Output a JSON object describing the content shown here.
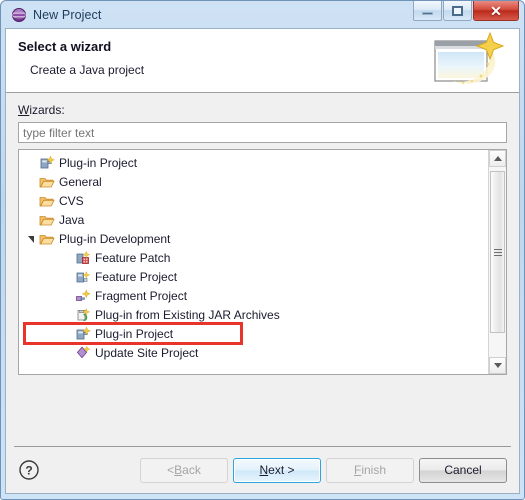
{
  "window": {
    "title": "New Project",
    "icon": "eclipse-sphere-icon",
    "controls": {
      "minimize": "Minimize",
      "maximize": "Maximize",
      "close": "Close",
      "close_glyph": "✕"
    }
  },
  "banner": {
    "title": "Select a wizard",
    "subtitle": "Create a Java project",
    "icon": "wizard-sparkle-icon"
  },
  "form": {
    "wizards_label_mnemonic": "W",
    "wizards_label_rest": "izards:",
    "filter_placeholder": "type filter text",
    "filter_value": ""
  },
  "tree": {
    "items": [
      {
        "label": "Plug-in Project",
        "level": 0,
        "twisty": "none",
        "icon": "plugin-project-icon",
        "highlighted": false
      },
      {
        "label": "General",
        "level": 0,
        "twisty": "collapsed",
        "icon": "folder-icon",
        "highlighted": false
      },
      {
        "label": "CVS",
        "level": 0,
        "twisty": "collapsed",
        "icon": "folder-icon",
        "highlighted": false
      },
      {
        "label": "Java",
        "level": 0,
        "twisty": "collapsed",
        "icon": "folder-icon",
        "highlighted": false
      },
      {
        "label": "Plug-in Development",
        "level": 0,
        "twisty": "expanded",
        "icon": "folder-icon",
        "highlighted": false
      },
      {
        "label": "Feature Patch",
        "level": 1,
        "twisty": "none",
        "icon": "feature-patch-icon",
        "highlighted": false
      },
      {
        "label": "Feature Project",
        "level": 1,
        "twisty": "none",
        "icon": "feature-project-icon",
        "highlighted": false
      },
      {
        "label": "Fragment Project",
        "level": 1,
        "twisty": "none",
        "icon": "fragment-project-icon",
        "highlighted": false
      },
      {
        "label": "Plug-in from Existing JAR Archives",
        "level": 1,
        "twisty": "none",
        "icon": "jar-archives-icon",
        "highlighted": false
      },
      {
        "label": "Plug-in Project",
        "level": 1,
        "twisty": "none",
        "icon": "plugin-project-icon",
        "highlighted": true
      },
      {
        "label": "Update Site Project",
        "level": 1,
        "twisty": "none",
        "icon": "update-site-icon",
        "highlighted": false
      }
    ],
    "annotation_color": "#e8342a",
    "scrollbar": {
      "up": "Scroll up",
      "down": "Scroll down",
      "thumb": "Scroll thumb"
    }
  },
  "footer": {
    "help": "?",
    "buttons": [
      {
        "name": "back",
        "prefix": "< ",
        "mnemonic": "B",
        "suffix": "ack",
        "state": "disabled"
      },
      {
        "name": "next",
        "prefix": "",
        "mnemonic": "N",
        "suffix": "ext >",
        "state": "default",
        "plain": "Next >"
      },
      {
        "name": "finish",
        "prefix": "",
        "mnemonic": "F",
        "suffix": "inish",
        "state": "disabled"
      },
      {
        "name": "cancel",
        "prefix": "",
        "mnemonic": "",
        "suffix": "Cancel",
        "state": "normal"
      }
    ]
  },
  "colors": {
    "accent_blue": "#2da4dd",
    "annotation_red": "#e8342a",
    "titlebar": "#cfe2f5",
    "dialog_bg": "#f0f0f0"
  }
}
